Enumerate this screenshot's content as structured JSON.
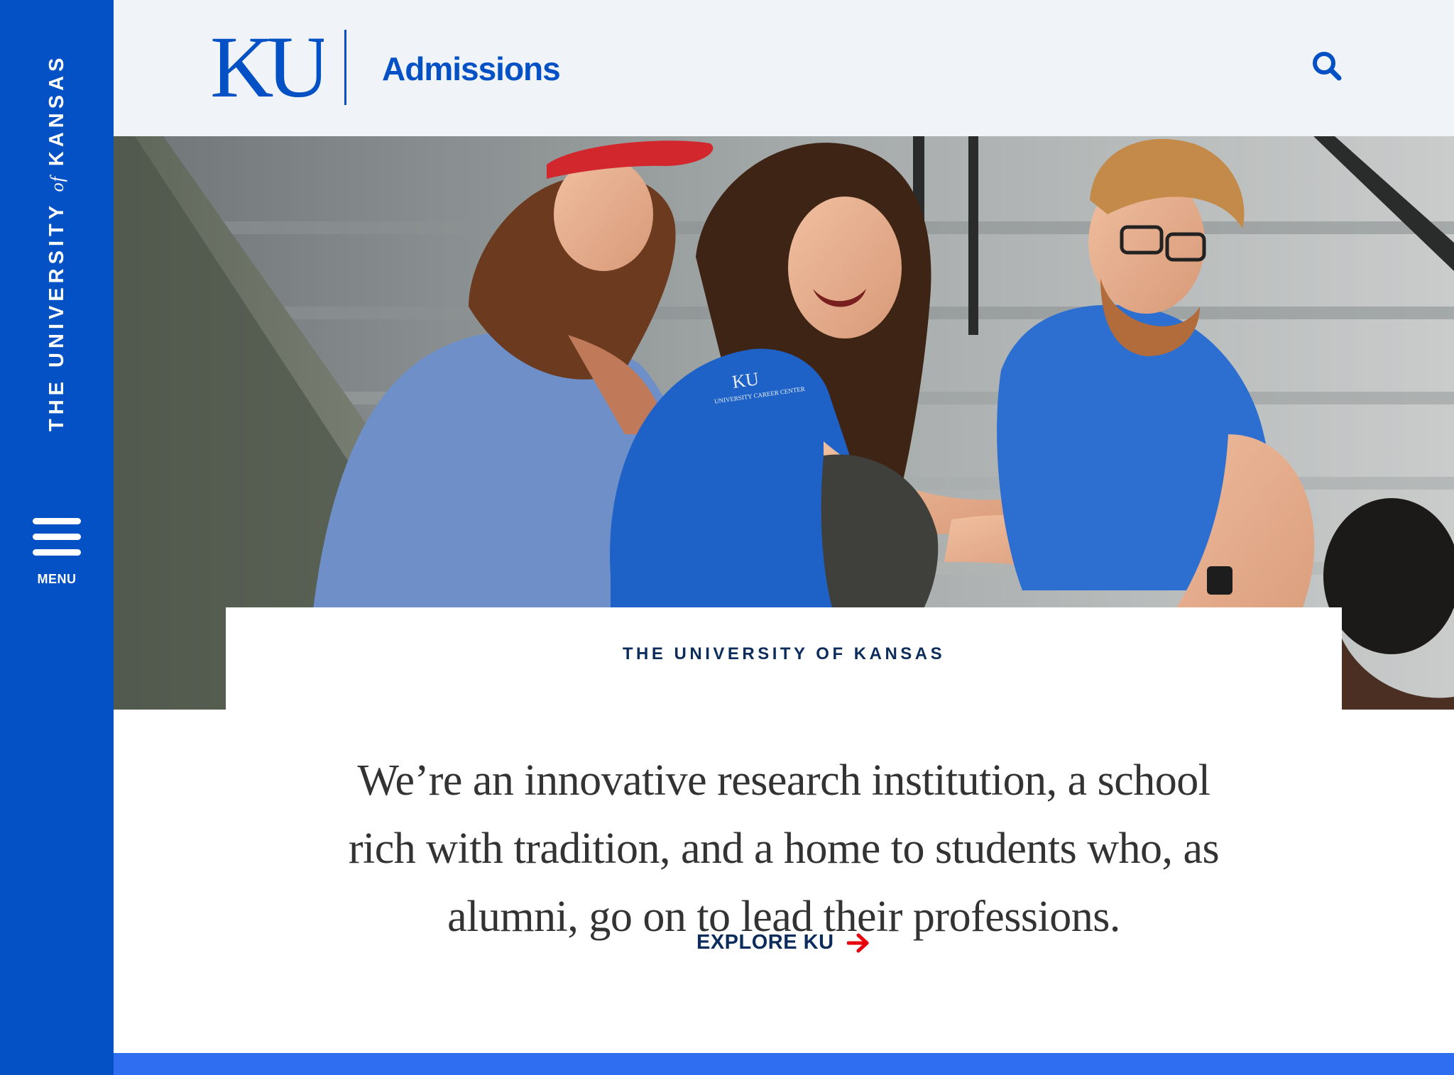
{
  "sidebar": {
    "wordmark_pre": "THE UNIVERSITY",
    "wordmark_of": "of",
    "wordmark_post": "KANSAS",
    "menu_label": "MENU"
  },
  "header": {
    "logo_text": "KU",
    "site_title": "Admissions",
    "search_icon": "search-icon"
  },
  "intro": {
    "eyebrow": "THE UNIVERSITY OF KANSAS",
    "text": "We’re an innovative research institution, a school rich with tradition, and a home to students who, as alumni, go on to lead their professions.",
    "cta_label": "EXPLORE KU",
    "cta_icon": "arrow-right-icon"
  },
  "hero": {
    "shirt_logo_text": "KU",
    "shirt_logo_sub": "UNIVERSITY CAREER CENTER"
  },
  "colors": {
    "brand_blue": "#0451c6",
    "bright_blue": "#2f6ef0",
    "navy": "#0c2c5c",
    "accent_red": "#e8000d",
    "header_bg": "#f0f4f8"
  }
}
